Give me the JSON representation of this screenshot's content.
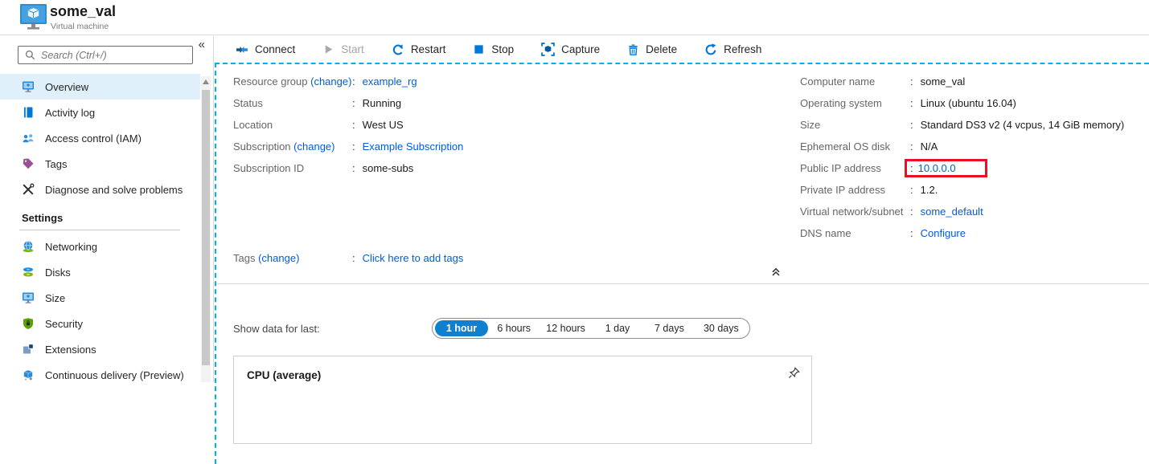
{
  "page": {
    "title": "some_val",
    "subtitle": "Virtual machine"
  },
  "punctuation": {
    "colon": ":"
  },
  "sidebar": {
    "collapse_glyph": "«",
    "search_placeholder": "Search (Ctrl+/)",
    "items": [
      {
        "label": "Overview",
        "selected": true
      },
      {
        "label": "Activity log"
      },
      {
        "label": "Access control (IAM)"
      },
      {
        "label": "Tags"
      },
      {
        "label": "Diagnose and solve problems"
      }
    ],
    "settings_heading": "Settings",
    "settings_items": [
      {
        "label": "Networking"
      },
      {
        "label": "Disks"
      },
      {
        "label": "Size"
      },
      {
        "label": "Security"
      },
      {
        "label": "Extensions"
      },
      {
        "label": "Continuous delivery (Preview)"
      }
    ]
  },
  "toolbar": {
    "buttons": [
      {
        "label": "Connect",
        "icon": "connect-icon",
        "disabled": false
      },
      {
        "label": "Start",
        "icon": "play-icon",
        "disabled": true
      },
      {
        "label": "Restart",
        "icon": "restart-icon",
        "disabled": false
      },
      {
        "label": "Stop",
        "icon": "stop-icon",
        "disabled": false
      },
      {
        "label": "Capture",
        "icon": "capture-icon",
        "disabled": false
      },
      {
        "label": "Delete",
        "icon": "trash-icon",
        "disabled": false
      },
      {
        "label": "Refresh",
        "icon": "refresh-icon",
        "disabled": false
      }
    ]
  },
  "essentials": {
    "left": [
      {
        "label": "Resource group",
        "label_link": "(change)",
        "value": "example_rg",
        "value_is_link": true
      },
      {
        "label": "Status",
        "value": "Running"
      },
      {
        "label": "Location",
        "value": "West US"
      },
      {
        "label": "Subscription",
        "label_link": "(change)",
        "value": "Example Subscription",
        "value_is_link": true
      },
      {
        "label": "Subscription ID",
        "value": "some-subs"
      }
    ],
    "right": [
      {
        "label": "Computer name",
        "value": "some_val"
      },
      {
        "label": "Operating system",
        "value": "Linux (ubuntu 16.04)"
      },
      {
        "label": "Size",
        "value": "Standard DS3 v2 (4 vcpus, 14 GiB memory)"
      },
      {
        "label": "Ephemeral OS disk",
        "value": "N/A"
      },
      {
        "label": "Public IP address",
        "value": "10.0.0.0",
        "value_is_link": true,
        "highlighted": true
      },
      {
        "label": "Private IP address",
        "value": "1.2."
      },
      {
        "label": "Virtual network/subnet",
        "value": "some_default",
        "value_is_link": true
      },
      {
        "label": "DNS name",
        "value": "Configure",
        "value_is_link": true
      }
    ],
    "tags": {
      "label": "Tags",
      "label_link": "(change)",
      "value": "Click here to add tags",
      "value_is_link": true
    }
  },
  "monitoring": {
    "show_data_label": "Show data for last:",
    "ranges": [
      "1 hour",
      "6 hours",
      "12 hours",
      "1 day",
      "7 days",
      "30 days"
    ],
    "selected_range": "1 hour",
    "chart_title": "CPU (average)"
  },
  "colors": {
    "link_blue": "#015cda",
    "toolbar_icon_blue": "#0078d4",
    "selected_pill_blue": "#0f7fd0",
    "sidebar_selected_bg": "#dff0fa",
    "dashed_focus_border": "#00b0f0",
    "highlight_red": "#e81123"
  }
}
